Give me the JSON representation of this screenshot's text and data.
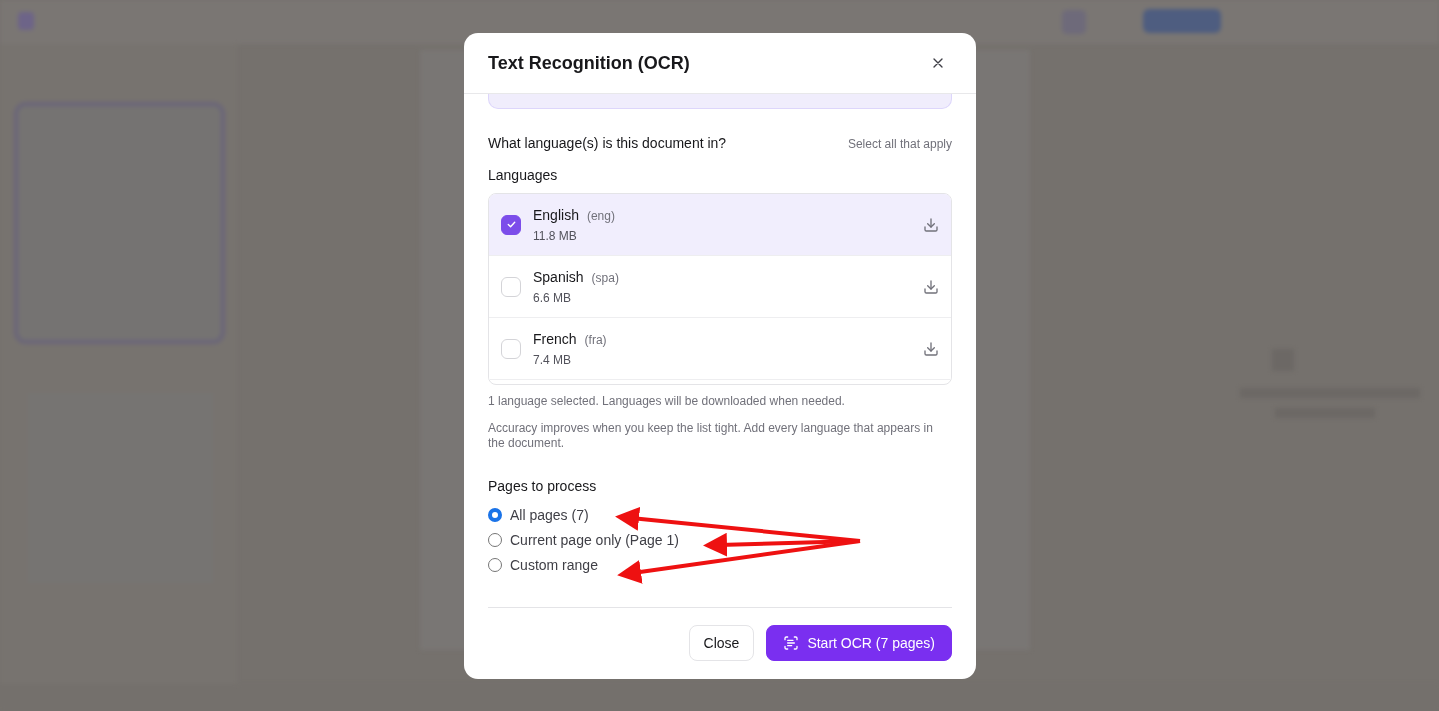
{
  "dialog": {
    "title": "Text Recognition (OCR)",
    "question": "What language(s) is this document in?",
    "hint": "Select all that apply",
    "languages_label": "Languages",
    "languages": [
      {
        "name": "English",
        "code": "(eng)",
        "size": "11.8 MB",
        "checked": true
      },
      {
        "name": "Spanish",
        "code": "(spa)",
        "size": "6.6 MB",
        "checked": false
      },
      {
        "name": "French",
        "code": "(fra)",
        "size": "7.4 MB",
        "checked": false
      }
    ],
    "selection_note": "1 language selected. Languages will be downloaded when needed.",
    "accuracy_note": "Accuracy improves when you keep the list tight. Add every language that appears in the document.",
    "pages_label": "Pages to process",
    "page_options": [
      {
        "label": "All pages (7)",
        "selected": true,
        "arrow_annotation": true
      },
      {
        "label": "Current page only (Page 1)",
        "selected": false,
        "arrow_annotation": true
      },
      {
        "label": "Custom range",
        "selected": false,
        "arrow_annotation": true
      }
    ],
    "close_button": "Close",
    "start_button": "Start OCR (7 pages)"
  }
}
